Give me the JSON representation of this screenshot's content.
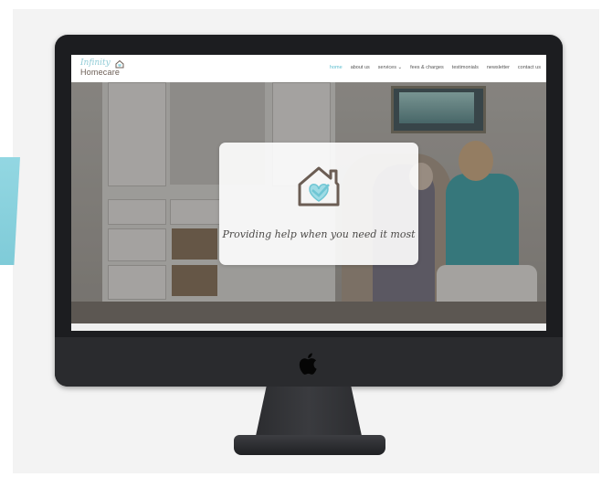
{
  "site": {
    "logo_script": "Infinity",
    "logo_main": "Homecare"
  },
  "nav": {
    "items": [
      {
        "label": "home",
        "active": true
      },
      {
        "label": "about us",
        "active": false
      },
      {
        "label": "services ⌄",
        "active": false
      },
      {
        "label": "fees & charges",
        "active": false
      },
      {
        "label": "testimonials",
        "active": false
      },
      {
        "label": "newsletter",
        "active": false
      },
      {
        "label": "contact us",
        "active": false
      }
    ]
  },
  "hero": {
    "tagline": "Providing help when you need it most",
    "icon": "house-heart-icon"
  },
  "device": {
    "logo_icon": "apple-logo-icon"
  },
  "colors": {
    "accent": "#5fbfd0",
    "logo_brown": "#6b5d54",
    "teal_decor": "#8fd3df"
  }
}
